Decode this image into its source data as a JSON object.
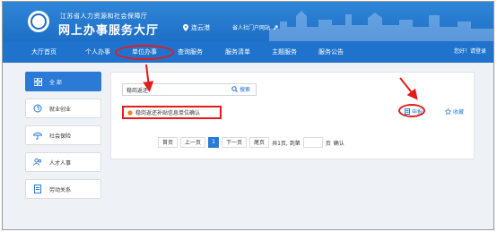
{
  "header": {
    "org": "江苏省人力资源和社会保障厅",
    "title": "网上办事服务大厅",
    "location": "连云港",
    "portal_link": "省人社门户网站"
  },
  "nav": {
    "items": [
      "大厅首页",
      "个人办事",
      "单位办事",
      "查询服务",
      "服务清单",
      "主题服务",
      "服务公告"
    ],
    "login": "您好！请登录"
  },
  "sidebar": {
    "items": [
      "全 部",
      "就业创业",
      "社会保险",
      "人才人事",
      "劳动关系"
    ]
  },
  "search": {
    "value": "稳岗返还",
    "button": "搜索"
  },
  "result": {
    "label": "稳岗返还补贴信息单位确认",
    "apply": "申报",
    "favorite": "收藏"
  },
  "pager": {
    "first": "首页",
    "prev": "上一页",
    "current": "1",
    "next": "下一页",
    "last": "尾页",
    "total": "共1页, 到第",
    "page_unit": "页",
    "confirm": "确认"
  },
  "colors": {
    "header": "#1e6fc6",
    "accent": "#2a7ad6",
    "annotation": "#e41b1b"
  }
}
